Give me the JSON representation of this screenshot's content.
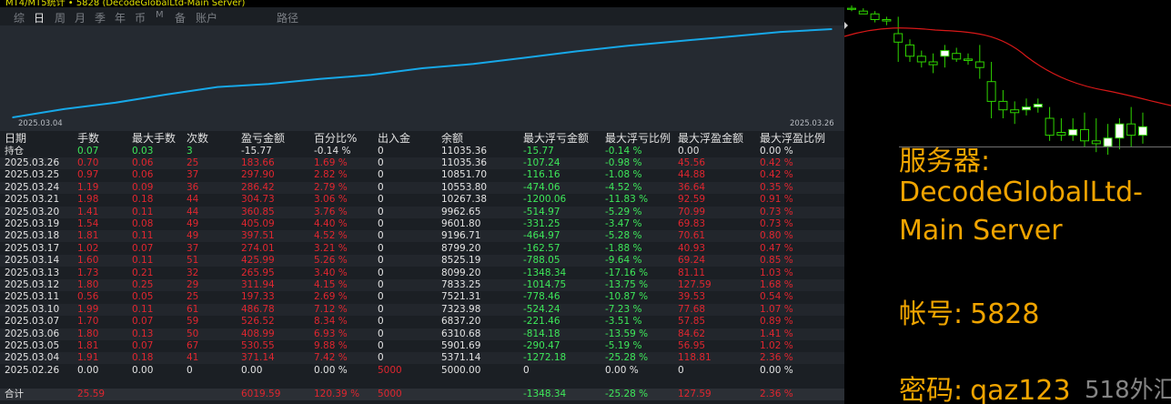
{
  "window": {
    "title": "MT4/MT5统计 • 5828 (DecodeGlobalLtd-Main Server)"
  },
  "tabs": [
    {
      "label": "综",
      "active": false
    },
    {
      "label": "日",
      "active": true
    },
    {
      "label": "周",
      "active": false
    },
    {
      "label": "月",
      "active": false
    },
    {
      "label": "季",
      "active": false
    },
    {
      "label": "年",
      "active": false
    },
    {
      "label": "币",
      "active": false
    },
    {
      "label": "M",
      "active": false
    },
    {
      "label": "备",
      "active": false
    },
    {
      "label": "账户",
      "active": false
    },
    {
      "label": "路径",
      "active": false
    }
  ],
  "chart_data": {
    "type": "line",
    "x_start_label": "2025.03.04",
    "x_end_label": "2025.03.26",
    "x": [
      "2025.02.26",
      "2025.03.04",
      "2025.03.05",
      "2025.03.06",
      "2025.03.07",
      "2025.03.10",
      "2025.03.11",
      "2025.03.12",
      "2025.03.13",
      "2025.03.14",
      "2025.03.17",
      "2025.03.18",
      "2025.03.19",
      "2025.03.20",
      "2025.03.21",
      "2025.03.24",
      "2025.03.25",
      "2025.03.26"
    ],
    "values": [
      5000.0,
      5371.14,
      5901.69,
      6310.68,
      6837.2,
      7323.98,
      7521.31,
      7833.25,
      8099.2,
      8525.19,
      8799.2,
      9196.71,
      9601.8,
      9962.65,
      10267.38,
      10553.8,
      10851.7,
      11035.36
    ],
    "line_color": "#17a8e8",
    "grid": false
  },
  "table": {
    "headers": [
      "日期",
      "手数",
      "最大手数",
      "次数",
      "盈亏金额",
      "百分比%",
      "出入金",
      "余额",
      "最大浮亏金额",
      "最大浮亏比例",
      "最大浮盈金额",
      "最大浮盈比例"
    ],
    "holding": {
      "date": "持仓",
      "lots": "0.07",
      "max_lots": "0.03",
      "count": "3",
      "pnl": "-15.77",
      "pct": "-0.14 %",
      "deposit": "0",
      "balance": "11035.36",
      "max_fl": "-15.77",
      "max_fl_pct": "-0.14 %",
      "max_fp": "0.00",
      "max_fp_pct": "0.00 %"
    },
    "rows": [
      {
        "date": "2025.03.26",
        "lots": "0.70",
        "max_lots": "0.06",
        "count": "25",
        "pnl": "183.66",
        "pct": "1.69 %",
        "deposit": "0",
        "balance": "11035.36",
        "max_fl": "-107.24",
        "max_fl_pct": "-0.98 %",
        "max_fp": "45.56",
        "max_fp_pct": "0.42 %"
      },
      {
        "date": "2025.03.25",
        "lots": "0.97",
        "max_lots": "0.06",
        "count": "37",
        "pnl": "297.90",
        "pct": "2.82 %",
        "deposit": "0",
        "balance": "10851.70",
        "max_fl": "-116.16",
        "max_fl_pct": "-1.08 %",
        "max_fp": "44.88",
        "max_fp_pct": "0.42 %"
      },
      {
        "date": "2025.03.24",
        "lots": "1.19",
        "max_lots": "0.09",
        "count": "36",
        "pnl": "286.42",
        "pct": "2.79 %",
        "deposit": "0",
        "balance": "10553.80",
        "max_fl": "-474.06",
        "max_fl_pct": "-4.52 %",
        "max_fp": "36.64",
        "max_fp_pct": "0.35 %"
      },
      {
        "date": "2025.03.21",
        "lots": "1.98",
        "max_lots": "0.18",
        "count": "44",
        "pnl": "304.73",
        "pct": "3.06 %",
        "deposit": "0",
        "balance": "10267.38",
        "max_fl": "-1200.06",
        "max_fl_pct": "-11.83 %",
        "max_fp": "92.59",
        "max_fp_pct": "0.91 %"
      },
      {
        "date": "2025.03.20",
        "lots": "1.41",
        "max_lots": "0.11",
        "count": "44",
        "pnl": "360.85",
        "pct": "3.76 %",
        "deposit": "0",
        "balance": "9962.65",
        "max_fl": "-514.97",
        "max_fl_pct": "-5.29 %",
        "max_fp": "70.99",
        "max_fp_pct": "0.73 %"
      },
      {
        "date": "2025.03.19",
        "lots": "1.54",
        "max_lots": "0.08",
        "count": "49",
        "pnl": "405.09",
        "pct": "4.40 %",
        "deposit": "0",
        "balance": "9601.80",
        "max_fl": "-331.25",
        "max_fl_pct": "-3.47 %",
        "max_fp": "69.83",
        "max_fp_pct": "0.73 %"
      },
      {
        "date": "2025.03.18",
        "lots": "1.81",
        "max_lots": "0.11",
        "count": "49",
        "pnl": "397.51",
        "pct": "4.52 %",
        "deposit": "0",
        "balance": "9196.71",
        "max_fl": "-464.97",
        "max_fl_pct": "-5.28 %",
        "max_fp": "70.61",
        "max_fp_pct": "0.80 %"
      },
      {
        "date": "2025.03.17",
        "lots": "1.02",
        "max_lots": "0.07",
        "count": "37",
        "pnl": "274.01",
        "pct": "3.21 %",
        "deposit": "0",
        "balance": "8799.20",
        "max_fl": "-162.57",
        "max_fl_pct": "-1.88 %",
        "max_fp": "40.93",
        "max_fp_pct": "0.47 %"
      },
      {
        "date": "2025.03.14",
        "lots": "1.60",
        "max_lots": "0.11",
        "count": "51",
        "pnl": "425.99",
        "pct": "5.26 %",
        "deposit": "0",
        "balance": "8525.19",
        "max_fl": "-788.05",
        "max_fl_pct": "-9.64 %",
        "max_fp": "69.24",
        "max_fp_pct": "0.85 %"
      },
      {
        "date": "2025.03.13",
        "lots": "1.73",
        "max_lots": "0.21",
        "count": "32",
        "pnl": "265.95",
        "pct": "3.40 %",
        "deposit": "0",
        "balance": "8099.20",
        "max_fl": "-1348.34",
        "max_fl_pct": "-17.16 %",
        "max_fp": "81.11",
        "max_fp_pct": "1.03 %"
      },
      {
        "date": "2025.03.12",
        "lots": "1.80",
        "max_lots": "0.25",
        "count": "29",
        "pnl": "311.94",
        "pct": "4.15 %",
        "deposit": "0",
        "balance": "7833.25",
        "max_fl": "-1014.75",
        "max_fl_pct": "-13.75 %",
        "max_fp": "127.59",
        "max_fp_pct": "1.68 %"
      },
      {
        "date": "2025.03.11",
        "lots": "0.56",
        "max_lots": "0.05",
        "count": "25",
        "pnl": "197.33",
        "pct": "2.69 %",
        "deposit": "0",
        "balance": "7521.31",
        "max_fl": "-778.46",
        "max_fl_pct": "-10.87 %",
        "max_fp": "39.53",
        "max_fp_pct": "0.54 %"
      },
      {
        "date": "2025.03.10",
        "lots": "1.99",
        "max_lots": "0.11",
        "count": "61",
        "pnl": "486.78",
        "pct": "7.12 %",
        "deposit": "0",
        "balance": "7323.98",
        "max_fl": "-524.24",
        "max_fl_pct": "-7.23 %",
        "max_fp": "77.68",
        "max_fp_pct": "1.07 %"
      },
      {
        "date": "2025.03.07",
        "lots": "1.70",
        "max_lots": "0.07",
        "count": "59",
        "pnl": "526.52",
        "pct": "8.34 %",
        "deposit": "0",
        "balance": "6837.20",
        "max_fl": "-221.46",
        "max_fl_pct": "-3.51 %",
        "max_fp": "57.85",
        "max_fp_pct": "0.89 %"
      },
      {
        "date": "2025.03.06",
        "lots": "1.80",
        "max_lots": "0.13",
        "count": "50",
        "pnl": "408.99",
        "pct": "6.93 %",
        "deposit": "0",
        "balance": "6310.68",
        "max_fl": "-814.18",
        "max_fl_pct": "-13.59 %",
        "max_fp": "84.62",
        "max_fp_pct": "1.41 %"
      },
      {
        "date": "2025.03.05",
        "lots": "1.81",
        "max_lots": "0.07",
        "count": "67",
        "pnl": "530.55",
        "pct": "9.88 %",
        "deposit": "0",
        "balance": "5901.69",
        "max_fl": "-290.47",
        "max_fl_pct": "-5.19 %",
        "max_fp": "56.95",
        "max_fp_pct": "1.02 %"
      },
      {
        "date": "2025.03.04",
        "lots": "1.91",
        "max_lots": "0.18",
        "count": "41",
        "pnl": "371.14",
        "pct": "7.42 %",
        "deposit": "0",
        "balance": "5371.14",
        "max_fl": "-1272.18",
        "max_fl_pct": "-25.28 %",
        "max_fp": "118.81",
        "max_fp_pct": "2.36 %"
      },
      {
        "date": "2025.02.26",
        "lots": "0.00",
        "max_lots": "0.00",
        "count": "0",
        "pnl": "0.00",
        "pct": "0.00 %",
        "deposit": "5000",
        "balance": "5000.00",
        "max_fl": "0",
        "max_fl_pct": "0.00 %",
        "max_fp": "0",
        "max_fp_pct": "0.00 %"
      }
    ],
    "total": {
      "date": "合计",
      "lots": "25.59",
      "max_lots": "",
      "count": "",
      "pnl": "6019.59",
      "pct": "120.39 %",
      "deposit": "5000",
      "balance": "",
      "max_fl": "-1348.34",
      "max_fl_pct": "-25.28 %",
      "max_fp": "127.59",
      "max_fp_pct": "2.36 %"
    }
  },
  "info": {
    "server_label": "服务器:",
    "server_line1": "DecodeGlobalLtd-",
    "server_line2": "Main Server",
    "account_label": "帐号:",
    "account_value": "5828",
    "password_label": "密码:",
    "password_value": "qaz123"
  },
  "watermark": "518外汇网",
  "colors": {
    "profit": "#e0262f",
    "loss": "#3ee85a",
    "info": "#f0a400",
    "candle_line": "#2fd400",
    "ma_line": "#d81818"
  },
  "candles": [
    {
      "o": 1,
      "h": 0,
      "l": 2,
      "c": 1
    },
    {
      "o": 2,
      "h": 1,
      "l": 3,
      "c": 3
    },
    {
      "o": 3,
      "h": 2,
      "l": 6,
      "c": 5
    },
    {
      "o": 5,
      "h": 4,
      "l": 7,
      "c": 5.5
    },
    {
      "o": 10,
      "h": 4,
      "l": 20,
      "c": 13
    },
    {
      "o": 14,
      "h": 12,
      "l": 20,
      "c": 18
    },
    {
      "o": 18,
      "h": 16,
      "l": 22,
      "c": 20
    },
    {
      "o": 20,
      "h": 17,
      "l": 24,
      "c": 21
    },
    {
      "o": 18,
      "h": 14,
      "l": 22,
      "c": 16
    },
    {
      "o": 17,
      "h": 15,
      "l": 20,
      "c": 19
    },
    {
      "o": 19,
      "h": 17,
      "l": 21,
      "c": 19.5
    },
    {
      "o": 20,
      "h": 14,
      "l": 26,
      "c": 22
    },
    {
      "o": 27,
      "h": 20,
      "l": 40,
      "c": 34
    },
    {
      "o": 34,
      "h": 30,
      "l": 40,
      "c": 37
    },
    {
      "o": 37,
      "h": 34,
      "l": 42,
      "c": 38
    },
    {
      "o": 37,
      "h": 33,
      "l": 39,
      "c": 36
    },
    {
      "o": 36,
      "h": 33,
      "l": 38,
      "c": 35
    },
    {
      "o": 40,
      "h": 36,
      "l": 48,
      "c": 46
    },
    {
      "o": 45,
      "h": 40,
      "l": 48,
      "c": 46
    },
    {
      "o": 46,
      "h": 40,
      "l": 48,
      "c": 44
    },
    {
      "o": 44,
      "h": 38,
      "l": 50,
      "c": 48
    },
    {
      "o": 48,
      "h": 40,
      "l": 52,
      "c": 49
    },
    {
      "o": 50,
      "h": 42,
      "l": 53,
      "c": 47
    },
    {
      "o": 47,
      "h": 40,
      "l": 51,
      "c": 42
    },
    {
      "o": 42,
      "h": 36,
      "l": 50,
      "c": 46
    },
    {
      "o": 46,
      "h": 38,
      "l": 49,
      "c": 43
    }
  ]
}
